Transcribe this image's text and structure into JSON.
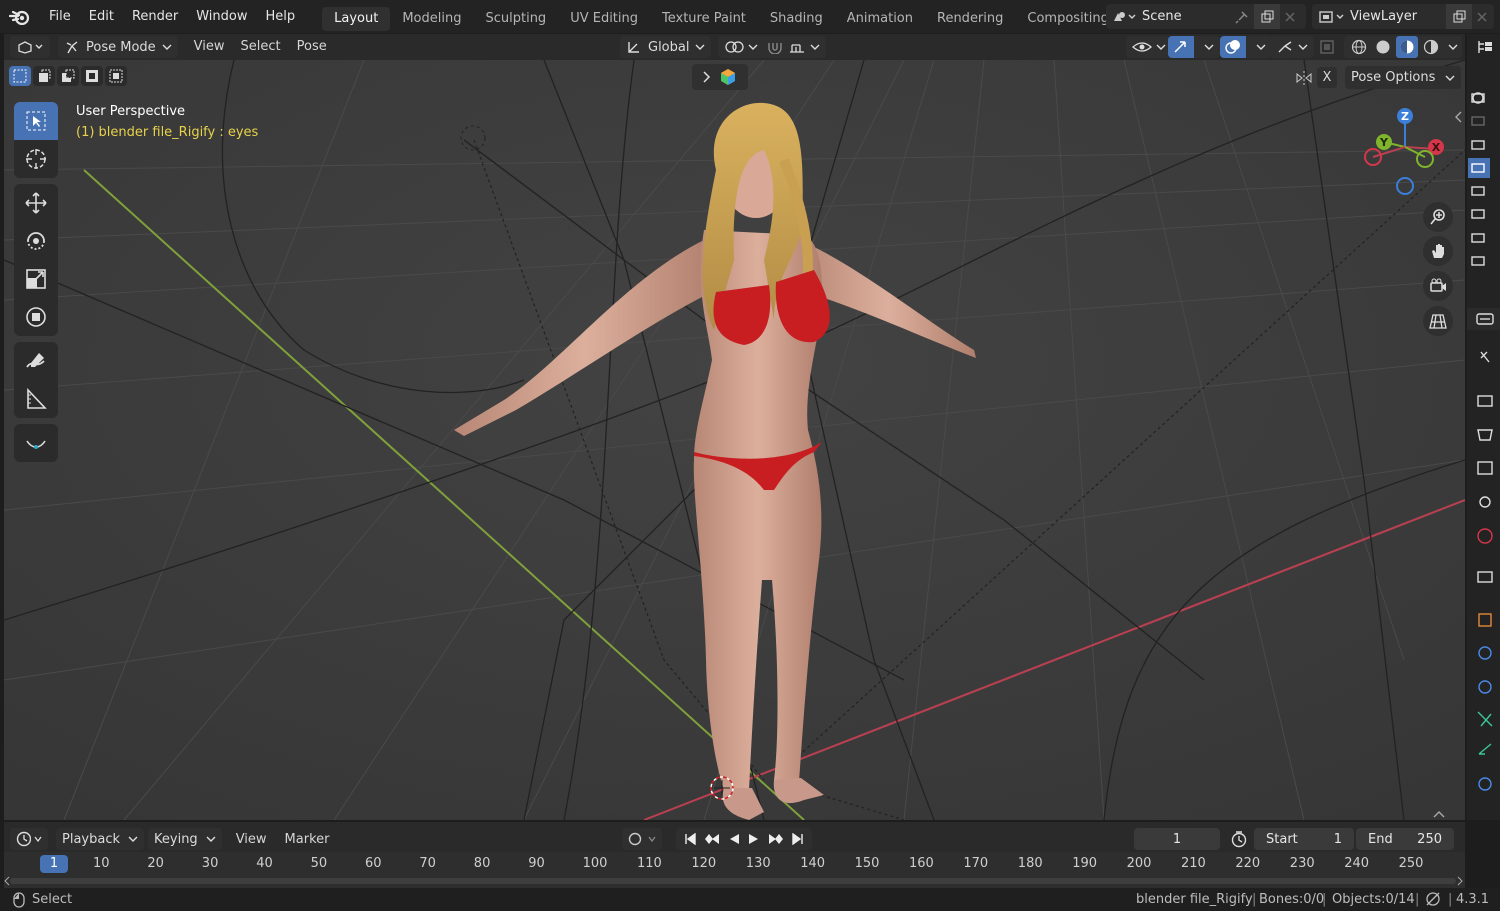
{
  "menu": [
    "File",
    "Edit",
    "Render",
    "Window",
    "Help"
  ],
  "workspaces": [
    {
      "label": "Layout",
      "active": true
    },
    {
      "label": "Modeling"
    },
    {
      "label": "Sculpting"
    },
    {
      "label": "UV Editing"
    },
    {
      "label": "Texture Paint"
    },
    {
      "label": "Shading"
    },
    {
      "label": "Animation"
    },
    {
      "label": "Rendering"
    },
    {
      "label": "Compositing"
    }
  ],
  "scene": {
    "name": "Scene"
  },
  "view_layer": {
    "name": "ViewLayer"
  },
  "viewport_header": {
    "mode": "Pose Mode",
    "view": "View",
    "select": "Select",
    "pose": "Pose",
    "orientation": "Global",
    "pose_options": "Pose Options",
    "x_mirror": "X"
  },
  "viewport": {
    "perspective": "User Perspective",
    "active_info": "(1) blender file_Rigify : eyes"
  },
  "gizmo": {
    "z": "Z",
    "y": "Y",
    "x": "X"
  },
  "timeline": {
    "playback": "Playback",
    "keying": "Keying",
    "view": "View",
    "marker": "Marker",
    "current_frame": "1",
    "start_label": "Start",
    "start": "1",
    "end_label": "End",
    "end": "250",
    "ruler": [
      "1",
      "10",
      "20",
      "30",
      "40",
      "50",
      "60",
      "70",
      "80",
      "90",
      "100",
      "110",
      "120",
      "130",
      "140",
      "150",
      "160",
      "170",
      "180",
      "190",
      "200",
      "210",
      "220",
      "230",
      "240",
      "250"
    ]
  },
  "status": {
    "select": "Select",
    "file": "blender file_Rigify",
    "bones": "Bones:0/0",
    "objects": "Objects:0/14",
    "version": "4.3.1"
  },
  "colors": {
    "accent": "#4772b3",
    "x_axis": "#d4374a",
    "y_axis": "#7fb42c",
    "z_axis": "#3b7fd9",
    "info_yellow": "#e8d24a"
  }
}
